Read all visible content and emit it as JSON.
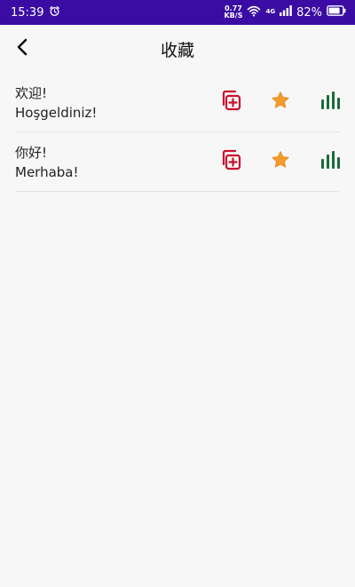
{
  "status_bar": {
    "time": "15:39",
    "net_speed_value": "0.77",
    "net_speed_unit": "KB/S",
    "network_type": "4G",
    "battery": "82%"
  },
  "header": {
    "title": "收藏"
  },
  "favorites": [
    {
      "chinese": "欢迎!",
      "turkish": "Hoşgeldiniz!"
    },
    {
      "chinese": "你好!",
      "turkish": "Merhaba!"
    }
  ],
  "colors": {
    "status_bar": "#3a0ca3",
    "copy_icon": "#c8102e",
    "star_icon": "#f39c2b",
    "stats_icon": "#1b6b3a"
  },
  "icons": {
    "back": "arrow-left-icon",
    "alarm": "alarm-icon",
    "wifi": "wifi-icon",
    "signal": "signal-icon",
    "battery": "battery-icon",
    "copy": "copy-add-icon",
    "favorite": "star-icon",
    "stats": "bar-chart-icon"
  }
}
